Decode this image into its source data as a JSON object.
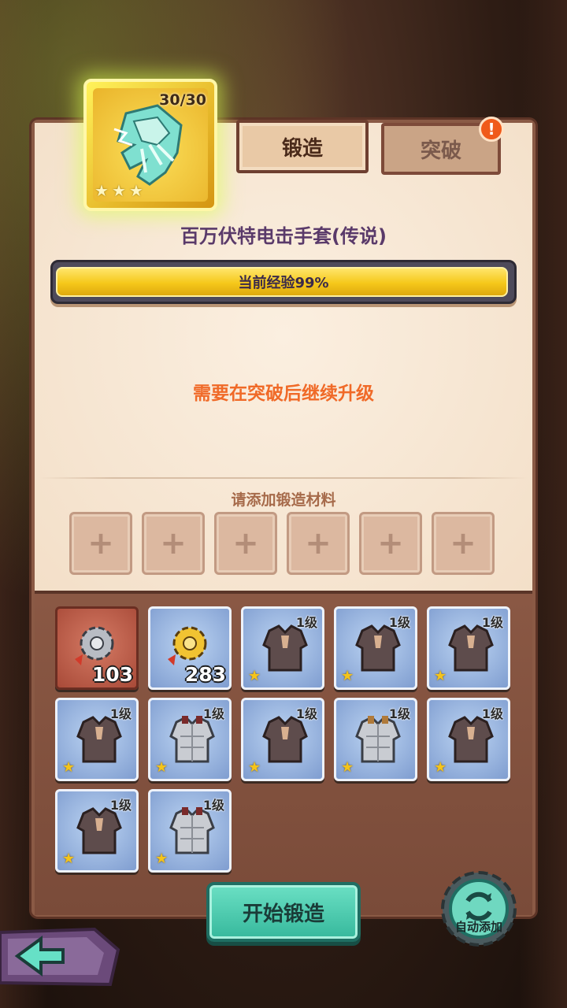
{
  "hero": {
    "count": "30/30",
    "stars": [
      "★",
      "★",
      "★"
    ]
  },
  "tabs": {
    "forge": "锻造",
    "breakthrough": "突破",
    "alert": "!"
  },
  "item_title": "百万伏特电击手套(传说)",
  "experience": {
    "label": "当前经验99%",
    "percent": 99
  },
  "notice": "需要在突破后继续升级",
  "materials": {
    "hint": "请添加锻造材料",
    "slots": [
      "+",
      "+",
      "+",
      "+",
      "+",
      "+"
    ]
  },
  "inventory": [
    {
      "kind": "silver-gear",
      "qty": "103",
      "bg": "red"
    },
    {
      "kind": "gold-gear",
      "qty": "283",
      "bg": "blue"
    },
    {
      "kind": "leather-armor",
      "level": "1级",
      "star": "★",
      "bg": "blue"
    },
    {
      "kind": "leather-armor",
      "level": "1级",
      "star": "★",
      "bg": "blue"
    },
    {
      "kind": "leather-armor",
      "level": "1级",
      "star": "★",
      "bg": "blue"
    },
    {
      "kind": "leather-armor",
      "level": "1级",
      "star": "★",
      "bg": "blue"
    },
    {
      "kind": "steel-armor",
      "level": "1级",
      "star": "★",
      "bg": "blue"
    },
    {
      "kind": "leather-armor",
      "level": "1级",
      "star": "★",
      "bg": "blue"
    },
    {
      "kind": "steel-armor",
      "level": "1级",
      "star": "★",
      "bg": "blue"
    },
    {
      "kind": "leather-armor",
      "level": "1级",
      "star": "★",
      "bg": "blue"
    },
    {
      "kind": "leather-armor",
      "level": "1级",
      "star": "★",
      "bg": "blue"
    },
    {
      "kind": "steel-armor",
      "level": "1级",
      "star": "★",
      "bg": "blue"
    }
  ],
  "buttons": {
    "start": "开始锻造",
    "auto_add": "自动添加"
  },
  "colors": {
    "accent_gold": "#f5c81a",
    "notice_orange": "#f06a28",
    "teal_button": "#36b89c"
  }
}
